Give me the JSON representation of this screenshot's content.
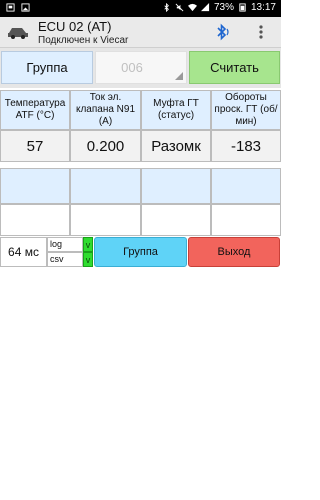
{
  "status_bar": {
    "battery": "73%",
    "time": "13:17",
    "left_icons": [
      "notification-icon",
      "image-icon"
    ],
    "right_icons": [
      "bluetooth-icon",
      "mute-icon",
      "wifi-icon",
      "signal-icon",
      "battery-icon"
    ]
  },
  "app_bar": {
    "title": "ECU 02 (AT)",
    "subtitle": "Подключен к Viecar",
    "icons": [
      "car-icon",
      "bluetooth-icon",
      "more-vert-icon"
    ]
  },
  "toolbar": {
    "group_label": "Группа",
    "group_value": "006",
    "read_label": "Считать"
  },
  "table": {
    "headers": [
      "Температура ATF (°C)",
      "Ток эл. клапана N91 (А)",
      "Муфта ГТ (статус)",
      "Обороты проск. ГТ (об/мин)"
    ],
    "values": [
      "57",
      "0.200",
      "Разомк",
      "-183"
    ]
  },
  "bottom": {
    "time": "64 мс",
    "log_label": "log",
    "csv_label": "csv",
    "log_check": "v",
    "csv_check": "v",
    "group_button": "Группа",
    "exit_button": "Выход"
  },
  "colors": {
    "header_bg": "#dfefff",
    "read_button": "#a7e58e",
    "group_button": "#5fd3f7",
    "exit_button": "#f2645c",
    "checkbox": "#2fdc2f",
    "bluetooth": "#1e66d0"
  }
}
